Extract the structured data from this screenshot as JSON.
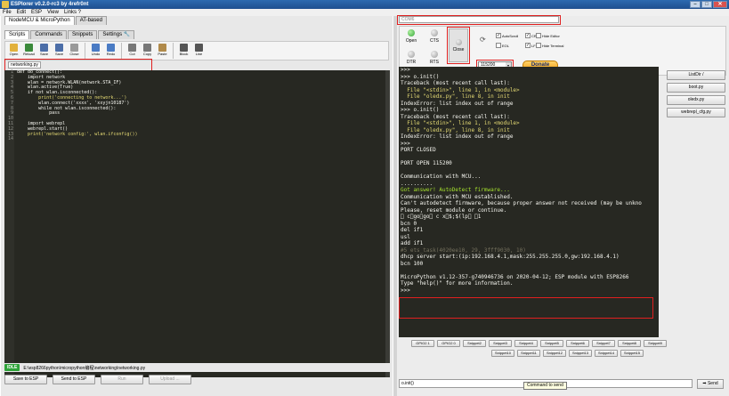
{
  "window": {
    "title": "ESPlorer v0.2.0-rc3 by 4refr0nt"
  },
  "menu": [
    "File",
    "Edit",
    "ESP",
    "View",
    "Links ?"
  ],
  "left": {
    "main_tabs": [
      "NodeMCU & MicroPython",
      "AT-based"
    ],
    "sub_tabs": [
      "Scripts",
      "Commands",
      "Snippets",
      "Settings"
    ],
    "toolbar": [
      {
        "label": "Open",
        "icon": "folder-open-icon",
        "color": "#e2b13c"
      },
      {
        "label": "Reload",
        "icon": "reload-icon",
        "color": "#3b8a3b"
      },
      {
        "label": "Save",
        "icon": "save-icon",
        "color": "#4c6ea8"
      },
      {
        "label": "Save",
        "icon": "save-all-icon",
        "color": "#4c6ea8"
      },
      {
        "label": "Close",
        "icon": "close-doc-icon",
        "color": "#9a9a9a"
      },
      {
        "label": "Undo",
        "icon": "undo-icon",
        "color": "#4a7bc4"
      },
      {
        "label": "Redo",
        "icon": "redo-icon",
        "color": "#4a7bc4"
      },
      {
        "label": "Cut",
        "icon": "cut-icon",
        "color": "#777777"
      },
      {
        "label": "Copy",
        "icon": "copy-icon",
        "color": "#777777"
      },
      {
        "label": "Paste",
        "icon": "paste-icon",
        "color": "#b08a4a"
      },
      {
        "label": "Block",
        "icon": "block-icon",
        "color": "#555555"
      },
      {
        "label": "Line",
        "icon": "line-icon",
        "color": "#555555"
      }
    ],
    "file_tab": "networking.py",
    "code_lines": [
      "def do_connect():",
      "    import network",
      "    wlan = network.WLAN(network.STA_IF)",
      "    wlan.active(True)",
      "    if not wlan.isconnected():",
      "        print('connecting to network...')",
      "        wlan.connect('xxxx', 'xxyjn10187')",
      "        while not wlan.isconnected():",
      "            pass",
      "",
      "    import webrepl",
      "    webrepl.start()",
      "    print('network config:', wlan.ifconfig())",
      ""
    ],
    "line_numbers": [
      "1",
      "2",
      "3",
      "4",
      "5",
      "6",
      "7",
      "8",
      "9",
      "10",
      "11",
      "12",
      "13",
      "14"
    ],
    "status_idle": "IDLE",
    "status_path": "E:\\esp8266python\\micropython编程\\networking\\networking.py",
    "bottom_buttons": [
      "Save to ESP",
      "Send to ESP",
      "Run",
      "Upload ..."
    ]
  },
  "right": {
    "port": "COM6",
    "buttons": {
      "open": "Open",
      "cts": "CTS",
      "close": "Close",
      "dtr": "DTR",
      "rts": "RTS"
    },
    "checkboxes": [
      {
        "label": "AutoScroll",
        "checked": true
      },
      {
        "label": "CR",
        "checked": true
      },
      {
        "label": "Hide Editor",
        "checked": false
      },
      {
        "label": "EOL",
        "checked": false
      },
      {
        "label": "LF",
        "checked": true
      },
      {
        "label": "Hide Terminal",
        "checked": false
      }
    ],
    "baud": "115200",
    "donate": "Donate",
    "terminal": [
      ">>>",
      ">>> o.init()",
      "Traceback (most recent call last):",
      "  File \"<stdin>\", line 1, in <module>",
      "  File \"oledx.py\", line 8, in init",
      "IndexError: list index out of range",
      ">>> o.init()",
      "Traceback (most recent call last):",
      "  File \"<stdin>\", line 1, in <module>",
      "  File \"oledx.py\", line 8, in init",
      "IndexError: list index out of range",
      ">>>",
      "PORT CLOSED",
      "",
      "PORT OPEN 115200",
      "",
      "Communication with MCU...",
      "..........",
      "Got answer! AutoDetect firmware...",
      "Communication with MCU established.",
      "Can't autodetect firmware, because proper answer not received (may be unkno",
      "Please, reset module or continue.",
      "\u0000 c\u0017go\u0003go\u0013 c x\u0004$;$(lp\u0003 \u00031",
      "bcn 0",
      "del if1",
      "usl",
      "add if1",
      "#5 ets_task(4020ee10, 29, 3fff9030, 10)",
      "dhcp server start:(ip:192.168.4.1,mask:255.255.255.0,gw:192.168.4.1)",
      "bcn 100",
      "",
      "MicroPython v1.12-357-g740946736 on 2020-04-12; ESP module with ESP8266",
      "Type \"help()\" for more information.",
      ">>>"
    ],
    "side_buttons": [
      "ListDir /",
      "boot.py",
      "oledx.py",
      "webrepl_cfg.py"
    ],
    "snippets_row1": [
      "GPIO2 1",
      "GPIO2 0",
      "Snippet2",
      "Snippet3",
      "Snippet4",
      "Snippet5",
      "Snippet6",
      "Snippet7",
      "Snippet8",
      "Snippet9"
    ],
    "snippets_row2": [
      "Snippet10",
      "Snippet11",
      "Snippet12",
      "Snippet13",
      "Snippet14",
      "Snippet15"
    ],
    "command_value": "o.init()",
    "tooltip": "Command to send",
    "send": "Send"
  }
}
